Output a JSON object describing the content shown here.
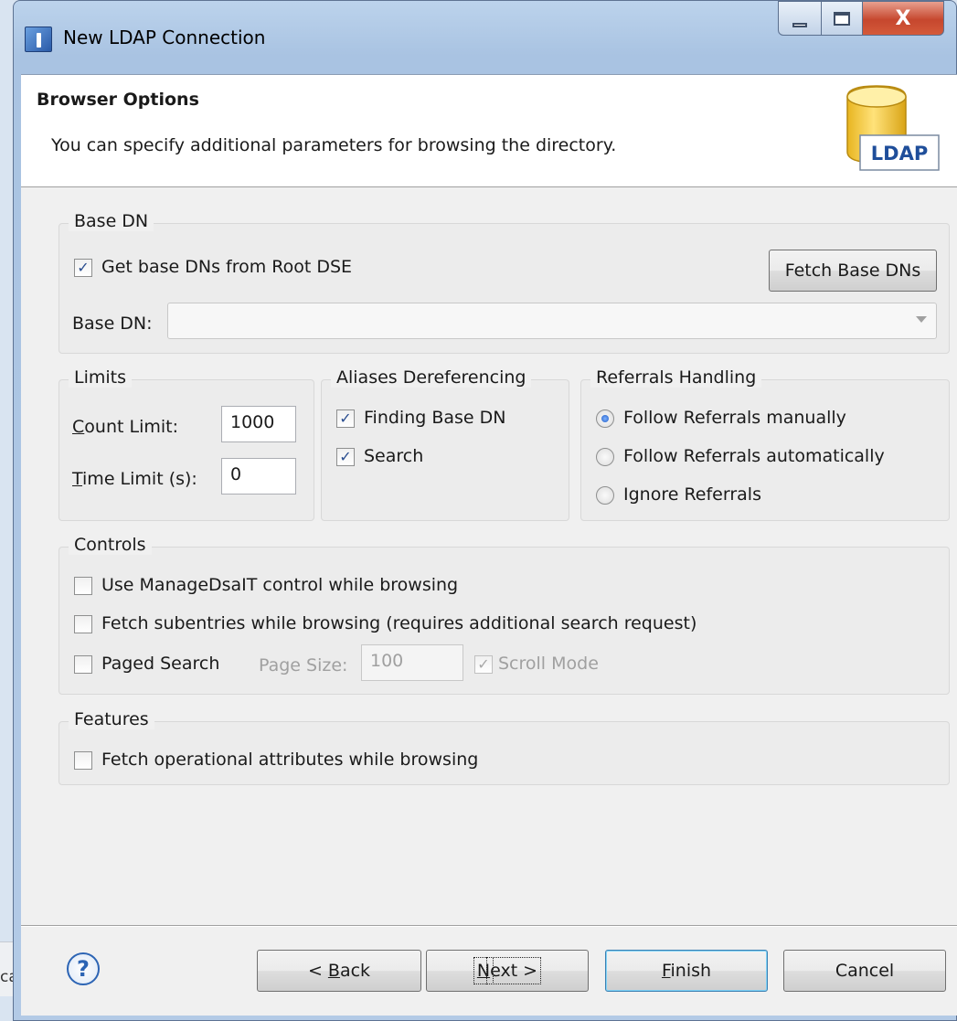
{
  "window": {
    "title": "New LDAP Connection",
    "close_glyph": "X"
  },
  "behind_text": "ca",
  "header": {
    "title": "Browser Options",
    "description": "You can specify additional parameters for browsing the directory.",
    "logo_text": "LDAP"
  },
  "base_dn_group": {
    "label": "Base DN",
    "get_from_root_label": "Get base DNs from Root DSE",
    "get_from_root_checked": true,
    "fetch_button": "Fetch Base DNs",
    "base_dn_label": "Base DN:",
    "base_dn_value": ""
  },
  "limits_group": {
    "label": "Limits",
    "count_limit_label_u": "C",
    "count_limit_label_rest": "ount Limit:",
    "count_limit_value": "1000",
    "time_limit_label_u": "T",
    "time_limit_label_rest": "ime Limit (s):",
    "time_limit_value": "0"
  },
  "aliases_group": {
    "label": "Aliases Dereferencing",
    "finding_base_dn": "Finding Base DN",
    "finding_base_dn_checked": true,
    "search": "Search",
    "search_checked": true
  },
  "referrals_group": {
    "label": "Referrals Handling",
    "options": [
      {
        "label": "Follow Referrals manually",
        "selected": true
      },
      {
        "label": "Follow Referrals automatically",
        "selected": false
      },
      {
        "label": "Ignore Referrals",
        "selected": false
      }
    ]
  },
  "controls_group": {
    "label": "Controls",
    "manage_dsait": "Use ManageDsaIT control while browsing",
    "fetch_subentries": "Fetch subentries while browsing (requires additional search request)",
    "paged_search": "Paged Search",
    "page_size_label": "Page Size:",
    "page_size_value": "100",
    "scroll_mode": "Scroll Mode"
  },
  "features_group": {
    "label": "Features",
    "fetch_operational": "Fetch operational attributes while browsing"
  },
  "footer": {
    "help_glyph": "?",
    "back_prefix": "< ",
    "back_u": "B",
    "back_rest": "ack",
    "next_u": "N",
    "next_rest": "ext >",
    "finish_u": "F",
    "finish_rest": "inish",
    "cancel": "Cancel"
  },
  "colors": {
    "accent": "#2c64b4",
    "logo_blue": "#1f4e9a",
    "logo_gold": "#f2c433"
  }
}
